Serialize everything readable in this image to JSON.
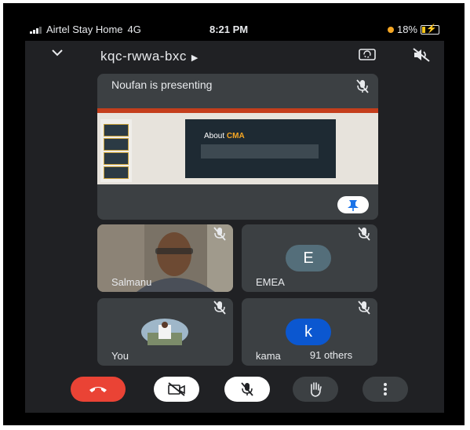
{
  "status_bar": {
    "carrier": "Airtel Stay Home",
    "network": "4G",
    "time": "8:21 PM",
    "battery": "18%",
    "battery_level": 0.18,
    "icons": [
      "signal-icon",
      "recording-dot-icon",
      "battery-charging-icon"
    ]
  },
  "topbar": {
    "meeting_code": "kqc-rwwa-bxc",
    "icons": [
      "chevron-down-icon",
      "camera-switch-icon",
      "speaker-off-icon"
    ]
  },
  "presentation": {
    "title": "Noufan is presenting",
    "slide_heading": "About",
    "slide_highlight": "CMA",
    "icons": [
      "mic-off-icon",
      "pin-icon"
    ]
  },
  "participants": [
    {
      "name": "Salmanu",
      "avatar": "",
      "muted": true
    },
    {
      "name": "EMEA",
      "avatar": "E",
      "muted": true
    },
    {
      "name": "You",
      "avatar": "",
      "muted": true
    },
    {
      "name": "kama",
      "avatar": "k",
      "muted": true
    }
  ],
  "others_count_label": "91 others",
  "colors": {
    "app_bg": "#202124",
    "tile_bg": "#3c4043",
    "end_call": "#ea4335",
    "avatar_emea": "#546e7a",
    "avatar_k": "#0b57d0"
  },
  "controls": [
    "end-call-icon",
    "camera-off-icon",
    "mic-off-icon",
    "raise-hand-icon",
    "more-vert-icon"
  ]
}
